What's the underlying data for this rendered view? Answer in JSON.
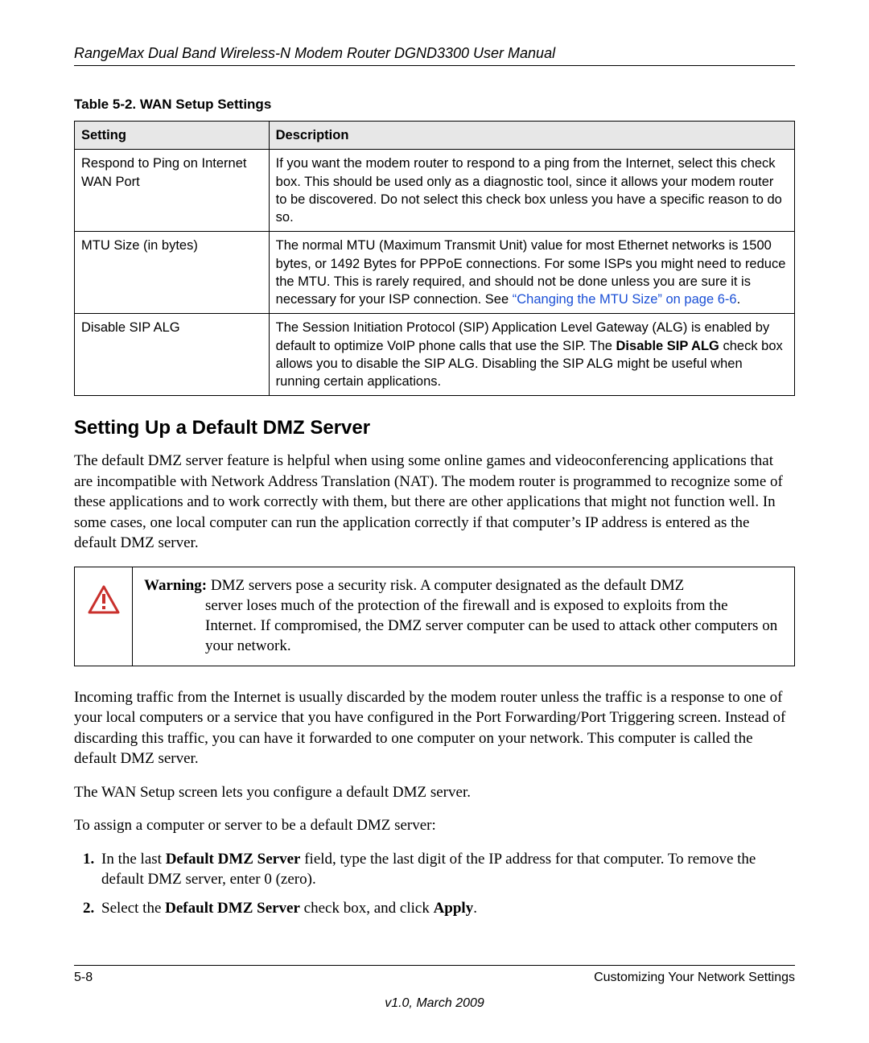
{
  "header": {
    "doc_title": "RangeMax Dual Band Wireless-N Modem Router DGND3300 User Manual"
  },
  "table": {
    "caption": "Table 5-2.   WAN Setup Settings",
    "headers": {
      "col1": "Setting",
      "col2": "Description"
    },
    "rows": [
      {
        "setting": "Respond to Ping on Internet WAN Port",
        "desc": "If you want the modem router to respond to a ping from the Internet, select this check box. This should be used only as a diagnostic tool, since it allows your modem router to be discovered. Do not select this check box unless you have a specific reason to do so."
      },
      {
        "setting": "MTU Size (in bytes)",
        "desc_pre": "The normal MTU (Maximum Transmit Unit) value for most Ethernet networks is 1500 bytes, or 1492 Bytes for PPPoE connections. For some ISPs you might need to reduce the MTU. This is rarely required, and should not be done unless you are sure it is necessary for your ISP connection. See ",
        "link": "“Changing the MTU Size” on page 6-6",
        "desc_post": "."
      },
      {
        "setting": "Disable SIP ALG",
        "desc_pre": "The Session Initiation Protocol (SIP) Application Level Gateway (ALG) is enabled by default to optimize VoIP phone calls that use the SIP. The ",
        "bold1": "Disable SIP ALG",
        "desc_post": " check box allows you to disable the SIP ALG. Disabling the SIP ALG might be useful when running certain applications."
      }
    ]
  },
  "section": {
    "heading": "Setting Up a Default DMZ Server",
    "para1": "The default DMZ server feature is helpful when using some online games and videoconferencing applications that are incompatible with Network Address Translation (NAT). The modem router is programmed to recognize some of these applications and to work correctly with them, but there are other applications that might not function well. In some cases, one local computer can run the application correctly if that computer’s IP address is entered as the default DMZ server."
  },
  "warning": {
    "label": "Warning:",
    "text_line1": " DMZ servers pose a security risk. A computer designated as the default DMZ",
    "text_rest": "server loses much of the protection of the firewall and is exposed to exploits from the Internet. If compromised, the DMZ server computer can be used to attack other computers on your network."
  },
  "after_warning": {
    "para2": "Incoming traffic from the Internet is usually discarded by the modem router unless the traffic is a response to one of your local computers or a service that you have configured in the Port Forwarding/Port Triggering screen. Instead of discarding this traffic, you can have it forwarded to one computer on your network. This computer is called the default DMZ server.",
    "para3": "The WAN Setup screen lets you configure a default DMZ server.",
    "para4": "To assign a computer or server to be a default DMZ server:"
  },
  "steps": {
    "s1_pre": "In the last ",
    "s1_b": "Default DMZ Server",
    "s1_post": " field, type the last digit of the IP address for that computer. To remove the default DMZ server, enter 0 (zero).",
    "s2_pre": "Select the ",
    "s2_b1": "Default DMZ Server",
    "s2_mid": " check box, and click ",
    "s2_b2": "Apply",
    "s2_post": "."
  },
  "footer": {
    "page": "5-8",
    "chapter": "Customizing Your Network Settings",
    "version": "v1.0, March 2009"
  }
}
